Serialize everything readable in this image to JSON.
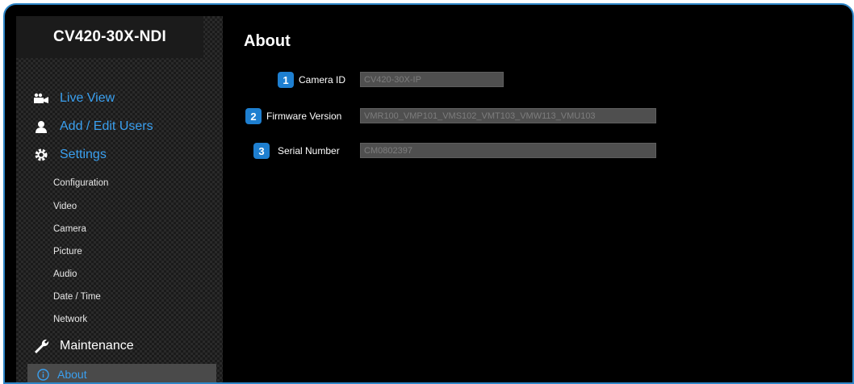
{
  "sidebar": {
    "model_name": "CV420-30X-NDI",
    "main_items": [
      {
        "label": "Live View",
        "icon": "video-camera-icon"
      },
      {
        "label": "Add / Edit Users",
        "icon": "user-icon"
      },
      {
        "label": "Settings",
        "icon": "gear-icon"
      },
      {
        "label": "Maintenance",
        "icon": "wrench-icon"
      }
    ],
    "settings_sub_items": [
      "Configuration",
      "Video",
      "Camera",
      "Picture",
      "Audio",
      "Date / Time",
      "Network"
    ],
    "active_item": {
      "label": "About",
      "icon": "info-icon"
    }
  },
  "main": {
    "title": "About",
    "fields": [
      {
        "badge": "1",
        "label": "Camera ID",
        "value": "CV420-30X-IP"
      },
      {
        "badge": "2",
        "label": "Firmware Version",
        "value": "VMR100_VMP101_VMS102_VMT103_VMW113_VMU103"
      },
      {
        "badge": "3",
        "label": "Serial Number",
        "value": "CM0802397"
      }
    ]
  },
  "colors": {
    "accent": "#3aa0f0",
    "badge": "#1e7fd0",
    "frame_border": "#2e86c8"
  }
}
